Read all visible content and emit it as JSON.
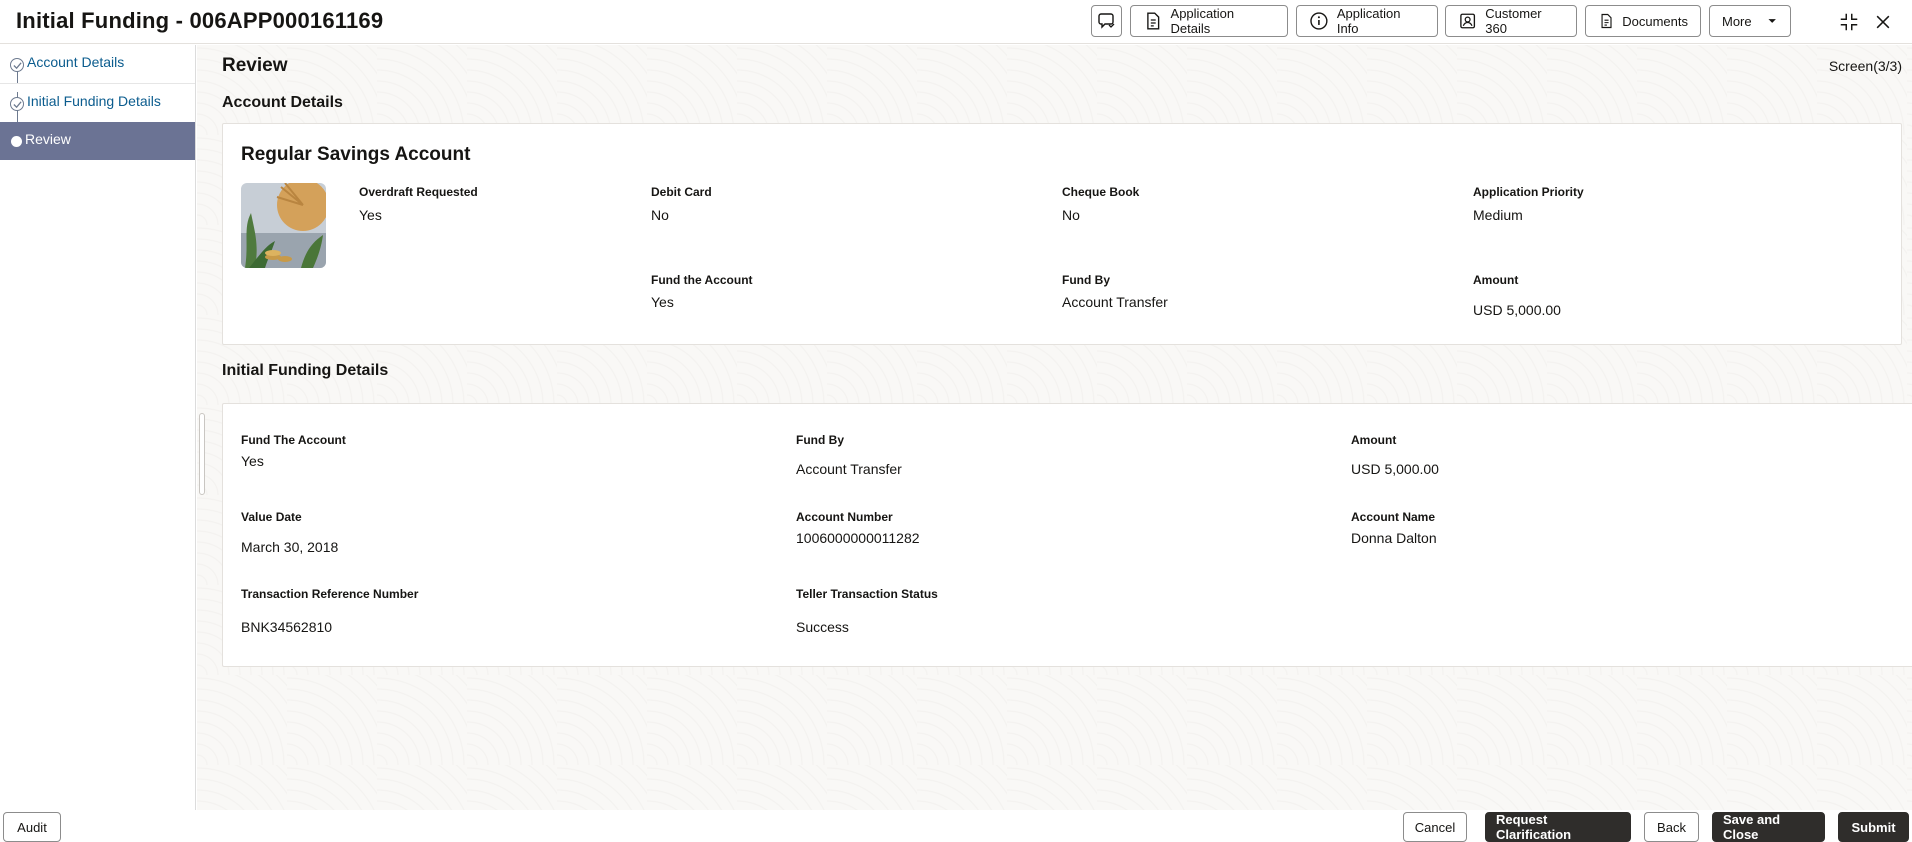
{
  "header": {
    "title": "Initial Funding - 006APP000161169",
    "buttons": {
      "application_details": "Application Details",
      "application_info": "Application Info",
      "customer_360": "Customer 360",
      "documents": "Documents",
      "more": "More"
    }
  },
  "sidebar": {
    "steps": [
      {
        "label": "Account Details",
        "state": "completed"
      },
      {
        "label": "Initial Funding Details",
        "state": "completed"
      },
      {
        "label": "Review",
        "state": "active"
      }
    ]
  },
  "main": {
    "title": "Review",
    "screen_indicator": "Screen(3/3)",
    "account_section": {
      "title": "Account Details",
      "account_name": "Regular Savings Account",
      "fields": {
        "overdraft": {
          "label": "Overdraft Requested",
          "value": "Yes"
        },
        "debit_card": {
          "label": "Debit Card",
          "value": "No"
        },
        "cheque_book": {
          "label": "Cheque Book",
          "value": "No"
        },
        "priority": {
          "label": "Application Priority",
          "value": "Medium"
        },
        "fund_account": {
          "label": "Fund the Account",
          "value": "Yes"
        },
        "fund_by": {
          "label": "Fund By",
          "value": "Account Transfer"
        },
        "amount": {
          "label": "Amount",
          "value": "USD 5,000.00"
        }
      }
    },
    "funding_section": {
      "title": "Initial Funding Details",
      "fields": {
        "fund_account": {
          "label": "Fund The Account",
          "value": "Yes"
        },
        "fund_by": {
          "label": "Fund By",
          "value": "Account Transfer"
        },
        "amount": {
          "label": "Amount",
          "value": "USD 5,000.00"
        },
        "value_date": {
          "label": "Value Date",
          "value": "March 30, 2018"
        },
        "account_number": {
          "label": "Account Number",
          "value": "1006000000011282"
        },
        "account_name": {
          "label": "Account Name",
          "value": "Donna Dalton"
        },
        "txn_ref": {
          "label": "Transaction Reference Number",
          "value": "BNK34562810"
        },
        "teller_status": {
          "label": "Teller Transaction Status",
          "value": "Success"
        }
      }
    }
  },
  "footer": {
    "audit": "Audit",
    "cancel": "Cancel",
    "request_clarification": "Request Clarification",
    "back": "Back",
    "save_and_close": "Save and Close",
    "submit": "Submit"
  },
  "colors": {
    "accent_link": "#0b5c8e",
    "active_step": "#6b7394",
    "primary_button": "#2f2d2b"
  }
}
